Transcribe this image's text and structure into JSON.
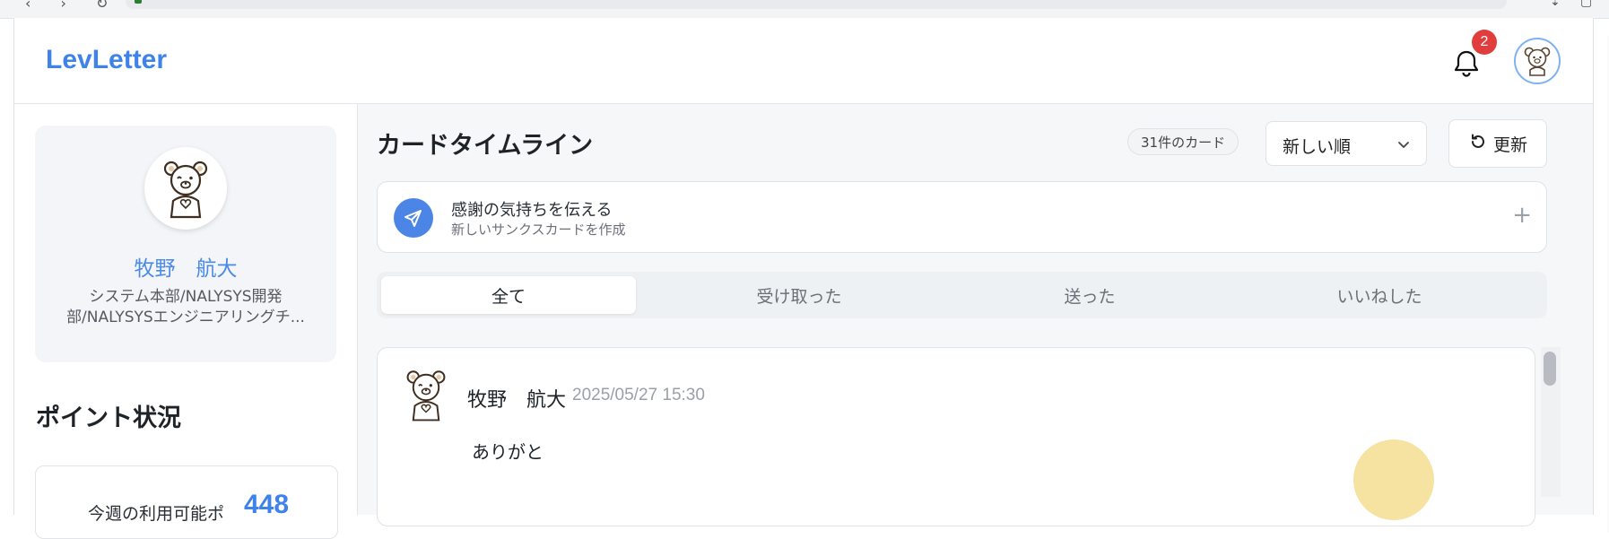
{
  "app": {
    "brand": "LevLetter",
    "notification_count": "2"
  },
  "profile": {
    "name": "牧野　航大",
    "department": "システム本部/NALYSYS開発部/NALYSYSエンジニアリングチ..."
  },
  "points": {
    "title": "ポイント状況",
    "label": "今週の利用可能ポ",
    "value": "448"
  },
  "main": {
    "title": "カードタイムライン",
    "count": "31件のカード",
    "sort": {
      "selected": "新しい順"
    },
    "refresh_label": "更新"
  },
  "compose": {
    "title": "感謝の気持ちを伝える",
    "subtitle": "新しいサンクスカードを作成",
    "plus": "+"
  },
  "tabs": [
    {
      "label": "全て",
      "active": true
    },
    {
      "label": "受け取った",
      "active": false
    },
    {
      "label": "送った",
      "active": false
    },
    {
      "label": "いいねした",
      "active": false
    }
  ],
  "cards": [
    {
      "sender": "牧野　航大",
      "time": "2025/05/27 15:30",
      "message": "ありがと"
    }
  ],
  "colors": {
    "accent": "#3f83ea",
    "badge": "#e23d3d",
    "send_button": "#4b86e6"
  }
}
